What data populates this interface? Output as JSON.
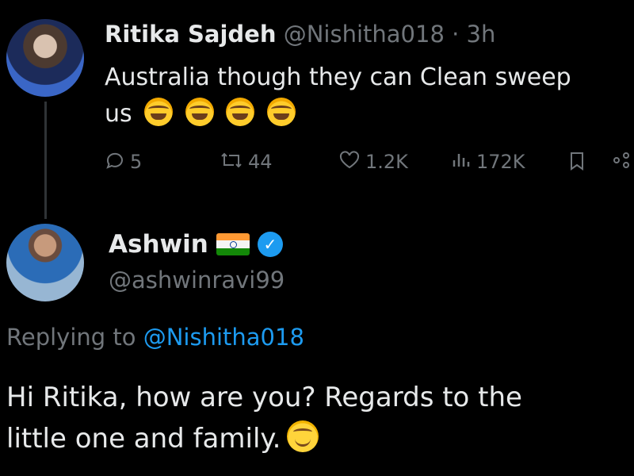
{
  "tweet1": {
    "name": "Ritika Sajdeh",
    "handle": "@Nishitha018",
    "separator": "·",
    "time": "3h",
    "text_line1": "Australia though they can Clean sweep",
    "text_line2": "us",
    "emojis": [
      "rofl-emoji",
      "rofl-emoji",
      "rofl-emoji",
      "rofl-emoji"
    ],
    "actions": {
      "replies": "5",
      "reposts": "44",
      "likes": "1.2K",
      "views": "172K"
    }
  },
  "tweet2": {
    "name": "Ashwin",
    "handle": "@ashwinravi99",
    "replying_prefix": "Replying to ",
    "replying_handle": "@Nishitha018",
    "text_line1": "Hi Ritika, how are you? Regards to the",
    "text_line2": "little one and family.",
    "emoji": "smiling-face-emoji"
  },
  "colors": {
    "background": "#000000",
    "text": "#e7e9ea",
    "muted": "#71767b",
    "link": "#1d9bf0",
    "verified": "#1d9bf0"
  }
}
